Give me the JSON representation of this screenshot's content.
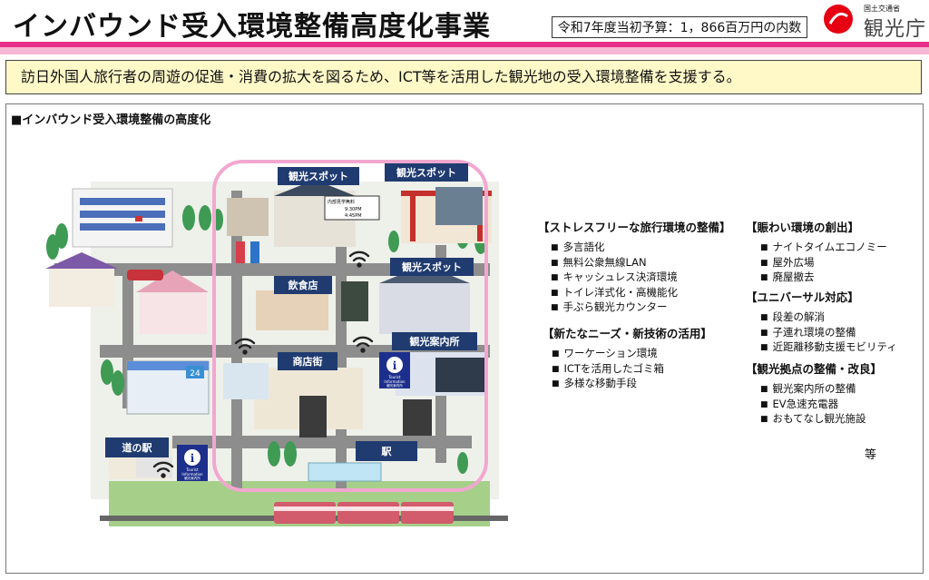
{
  "header": {
    "title": "インバウンド受入環境整備高度化事業",
    "budget": "令和7年度当初予算：1，866百万円の内数",
    "ministry": "国土交通省",
    "agency": "観光庁"
  },
  "summary": "訪日外国人旅行者の周遊の促進・消費の拡大を図るため、ICT等を活用した観光地の受入環境整備を支援する。",
  "section_heading": "■インバウンド受入環境整備の高度化",
  "illustration": {
    "labels": {
      "spot_a": "観光スポット",
      "spot_b": "観光スポット",
      "spot_c": "観光スポット",
      "restaurant": "飲食店",
      "shopping_street": "商店街",
      "tourist_info_center": "観光案内所",
      "roadside_station": "道の駅",
      "station": "駅"
    },
    "sign_text": [
      "内部見学無料",
      "9:30PM",
      "4:45PM"
    ],
    "tourist_info_text": [
      "Tourist",
      "Information",
      "観光案内所"
    ],
    "store_number": "24"
  },
  "categories": [
    {
      "title": "【ストレスフリーな旅行環境の整備】",
      "items": [
        "多言語化",
        "無料公衆無線LAN",
        "キャッシュレス決済環境",
        "トイレ洋式化・高機能化",
        "手ぶら観光カウンター"
      ]
    },
    {
      "title": "【新たなニーズ・新技術の活用】",
      "items": [
        "ワーケーション環境",
        "ICTを活用したゴミ箱",
        "多様な移動手段"
      ]
    },
    {
      "title": "【賑わい環境の創出】",
      "items": [
        "ナイトタイムエコノミー",
        "屋外広場",
        "廃屋撤去"
      ]
    },
    {
      "title": "【ユニバーサル対応】",
      "items": [
        "段差の解消",
        "子連れ環境の整備",
        "近距離移動支援モビリティ"
      ]
    },
    {
      "title": "【観光拠点の整備・改良】",
      "items": [
        "観光案内所の整備",
        "EV急速充電器",
        "おもてなし観光施設"
      ]
    }
  ],
  "etc": "等",
  "colors": {
    "pink": "#e8308a",
    "light_pink": "#f7b7d4",
    "summary_bg": "#fff9c8",
    "label_bg": "#1f3b70"
  }
}
